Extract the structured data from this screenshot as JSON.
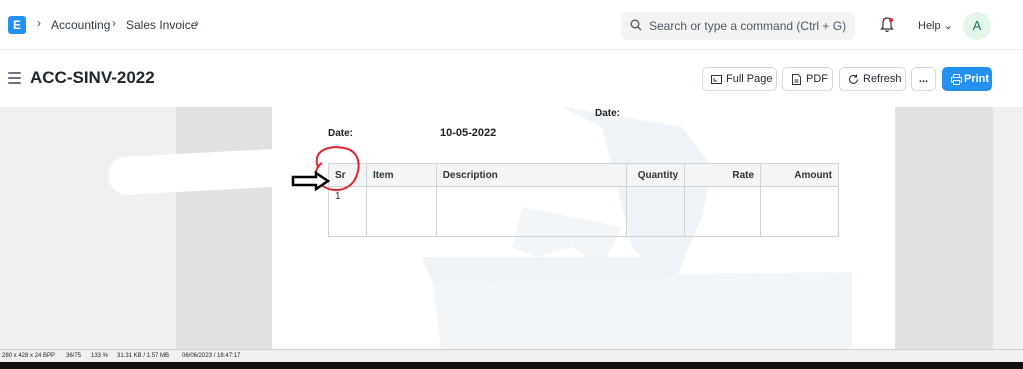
{
  "navbar": {
    "logo_letter": "E",
    "breadcrumbs": [
      "Accounting",
      "Sales Invoice"
    ],
    "search_placeholder": "Search or type a command (Ctrl + G)",
    "help_label": "Help",
    "avatar_letter": "A"
  },
  "page": {
    "title": "ACC-SINV-2022",
    "buttons": {
      "full_page": "Full Page",
      "pdf": "PDF",
      "refresh": "Refresh",
      "more": "...",
      "print": "Print"
    }
  },
  "document": {
    "date_label_top": "Date:",
    "date_label": "Date:",
    "date_value": "10-05-2022",
    "table_headers": [
      "Sr",
      "Item",
      "Description",
      "Quantity",
      "Rate",
      "Amount"
    ],
    "rows": [
      [
        "1",
        "",
        "",
        "",
        "",
        ""
      ]
    ]
  },
  "statusbar": {
    "image_info": "280 x 428 x 24 BPP",
    "index": "36/75",
    "zoom": "133 %",
    "size": "31.31 KB / 1.57 MB",
    "datetime": "06/06/2023 / 18:47:17"
  },
  "colors": {
    "primary": "#2490ef",
    "annotation_red": "#e3242b"
  }
}
